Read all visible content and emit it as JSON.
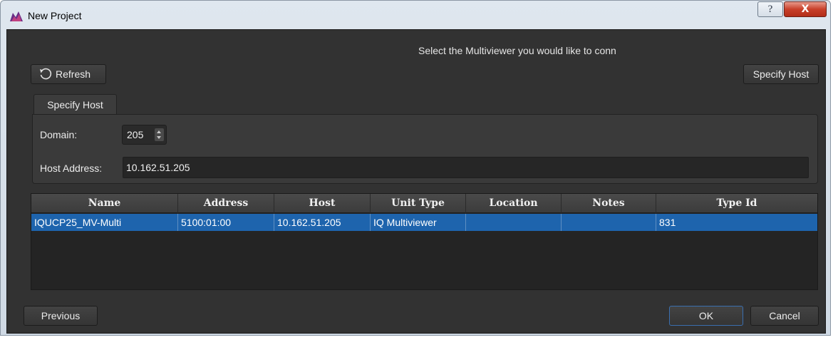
{
  "window": {
    "title": "New Project",
    "help_glyph": "?",
    "close_glyph": "X"
  },
  "dialog": {
    "prompt": "Select the Multiviewer you would like to conn",
    "refresh_label": "Refresh",
    "specify_host_button_label": "Specify Host",
    "tab_label": "Specify Host",
    "domain_label": "Domain:",
    "domain_value": "205",
    "host_address_label": "Host Address:",
    "host_address_value": "10.162.51.205"
  },
  "table": {
    "columns": [
      "Name",
      "Address",
      "Host",
      "Unit Type",
      "Location",
      "Notes",
      "Type Id"
    ],
    "rows": [
      [
        "IQUCP25_MV-Multi",
        "5100:01:00",
        "10.162.51.205",
        "IQ Multiviewer",
        "",
        "",
        "831"
      ]
    ],
    "selected_row": 0,
    "selection_color": "#1e64ad"
  },
  "footer": {
    "previous_label": "Previous",
    "ok_label": "OK",
    "cancel_label": "Cancel"
  },
  "colors": {
    "background": "#323232",
    "accent": "#1e64ad",
    "close_button": "#c8402a"
  }
}
